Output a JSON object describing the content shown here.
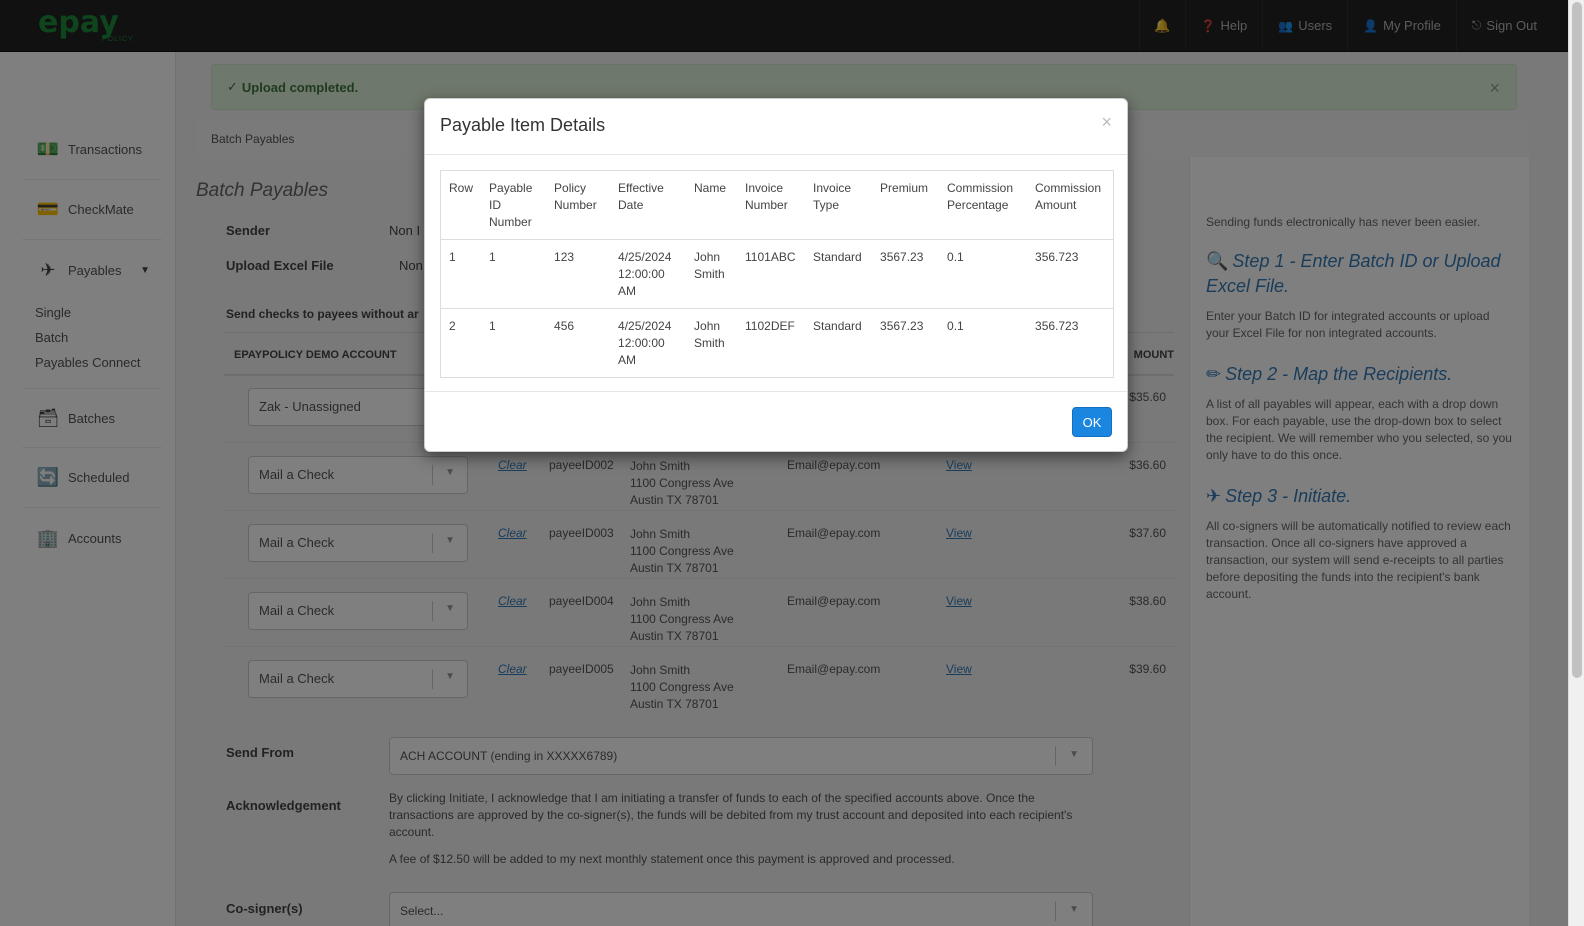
{
  "brand": {
    "logo_text": "epay",
    "logo_sub": "POLICY",
    "accent": "#1f8a3a"
  },
  "topnav": {
    "bell_icon": "bell-icon",
    "help": "Help",
    "users": "Users",
    "profile": "My Profile",
    "signout": "Sign Out"
  },
  "sidebar": {
    "transactions": "Transactions",
    "checkmate": "CheckMate",
    "payables": "Payables",
    "single": "Single",
    "batch": "Batch",
    "payables_connect": "Payables Connect",
    "batches": "Batches",
    "scheduled": "Scheduled",
    "accounts": "Accounts"
  },
  "alert": {
    "message": "Upload completed.",
    "close": "×"
  },
  "breadcrumb": "Batch Payables",
  "page": {
    "title": "Batch Payables",
    "sender_label": "Sender",
    "sender_value": "Non I",
    "upload_label": "Upload Excel File",
    "upload_value": "Non",
    "send_checks_note": "Send checks to payees without ar",
    "account_header": "EPAYPOLICY DEMO ACCOUNT",
    "amount_header": "MOUNT"
  },
  "payee_rows": [
    {
      "select": "Zak - Unassigned",
      "clear": "",
      "pid": "",
      "name": "",
      "street": "",
      "city": "",
      "email": "",
      "view": "",
      "amount": "$35.60"
    },
    {
      "select": "Mail a Check",
      "clear": "Clear",
      "pid": "payeeID002",
      "name": "John Smith",
      "street": "1100 Congress Ave",
      "city": "Austin TX 78701",
      "email": "Email@epay.com",
      "view": "View",
      "amount": "$36.60"
    },
    {
      "select": "Mail a Check",
      "clear": "Clear",
      "pid": "payeeID003",
      "name": "John Smith",
      "street": "1100 Congress Ave",
      "city": "Austin TX 78701",
      "email": "Email@epay.com",
      "view": "View",
      "amount": "$37.60"
    },
    {
      "select": "Mail a Check",
      "clear": "Clear",
      "pid": "payeeID004",
      "name": "John Smith",
      "street": "1100 Congress Ave",
      "city": "Austin TX 78701",
      "email": "Email@epay.com",
      "view": "View",
      "amount": "$38.60"
    },
    {
      "select": "Mail a Check",
      "clear": "Clear",
      "pid": "payeeID005",
      "name": "John Smith",
      "street": "1100 Congress Ave",
      "city": "Austin TX 78701",
      "email": "Email@epay.com",
      "view": "View",
      "amount": "$39.60"
    }
  ],
  "send_from": {
    "label": "Send From",
    "value": "ACH ACCOUNT (ending in XXXXX6789)"
  },
  "acknowledgement": {
    "label": "Acknowledgement",
    "text1": "By clicking Initiate, I acknowledge that I am initiating a transfer of funds to each of the specified accounts above. Once the transactions are approved by the co-signer(s), the funds will be debited from my trust account and deposited into each recipient's account.",
    "text2": "A fee of $12.50 will be added to my next monthly statement once this payment is approved and processed."
  },
  "cosigners": {
    "label": "Co-signer(s)",
    "placeholder": "Select..."
  },
  "help": {
    "intro": "Sending funds electronically has never been easier.",
    "step1": "Step 1 - Enter Batch ID or Upload Excel File.",
    "step1_desc": "Enter your Batch ID for integrated accounts or upload your Excel File for non integrated accounts.",
    "step2": "Step 2 - Map the Recipients.",
    "step2_desc": "A list of all payables will appear, each with a drop down box. For each payable, use the drop-down box to select the recipient. We will remember who you selected, so you only have to do this once.",
    "step3": "Step 3 - Initiate.",
    "step3_desc": "All co-signers will be automatically notified to review each transaction. Once all co-signers have approved a transaction, our system will send e-receipts to all parties before depositing the funds into the recipient's bank account."
  },
  "modal": {
    "title": "Payable Item Details",
    "close": "×",
    "columns": [
      "Row",
      "Payable ID Number",
      "Policy Number",
      "Effective Date",
      "Name",
      "Invoice Number",
      "Invoice Type",
      "Premium",
      "Commission Percentage",
      "Commission Amount"
    ],
    "rows": [
      [
        "1",
        "1",
        "123",
        "4/25/2024 12:00:00 AM",
        "John Smith",
        "1101ABC",
        "Standard",
        "3567.23",
        "0.1",
        "356.723"
      ],
      [
        "2",
        "1",
        "456",
        "4/25/2024 12:00:00 AM",
        "John Smith",
        "1102DEF",
        "Standard",
        "3567.23",
        "0.1",
        "356.723"
      ]
    ],
    "ok": "OK"
  }
}
